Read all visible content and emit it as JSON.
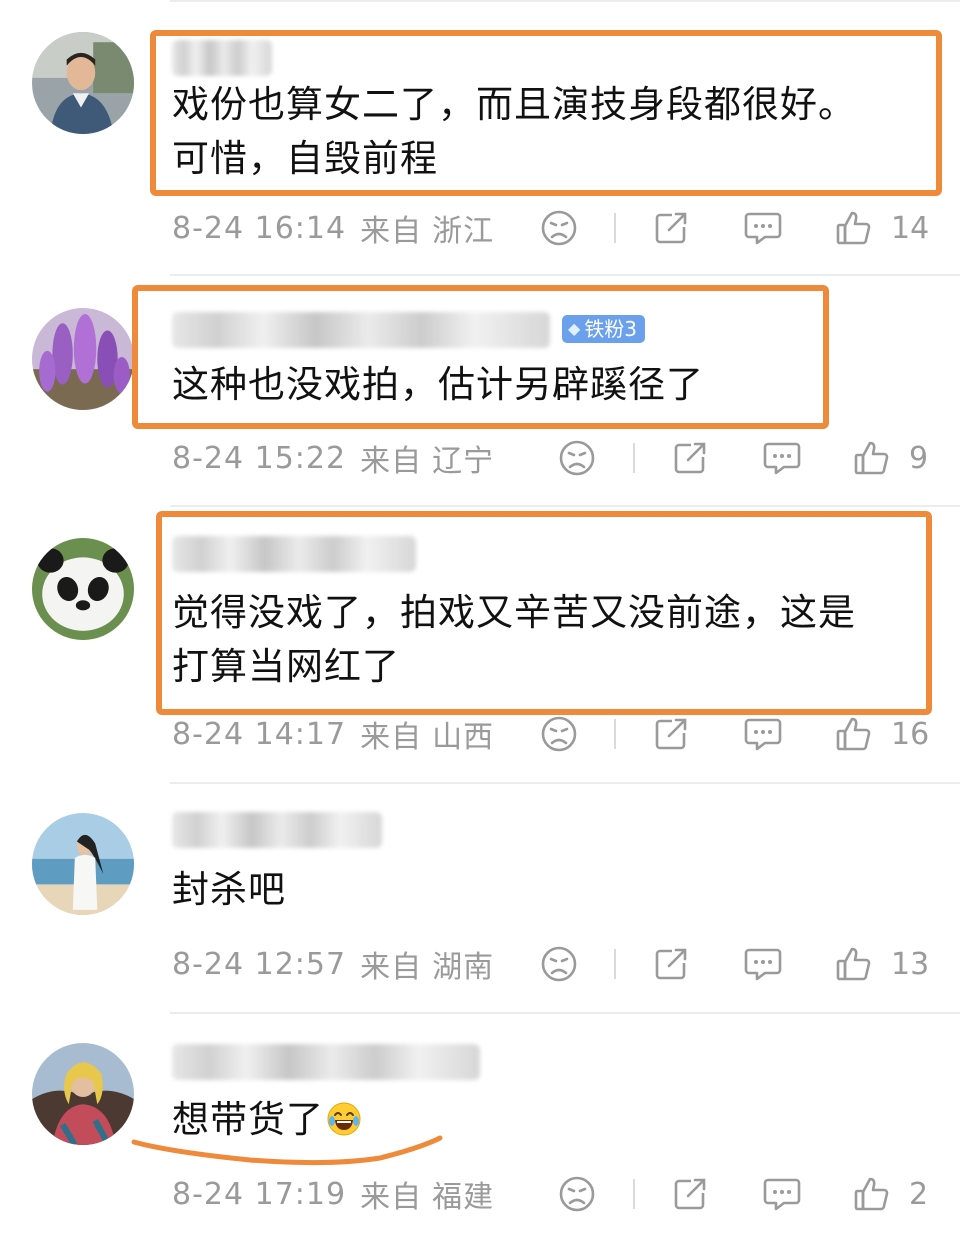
{
  "comments": [
    {
      "text_lines": [
        "戏份也算女二了，而且演技身段都很好。",
        "可惜，自毁前程"
      ],
      "date": "8-24 16:14",
      "from_label": "来自",
      "location": "浙江",
      "likes": "14",
      "avatar": "young-man-photo",
      "highlight": "orange-box"
    },
    {
      "text_lines": [
        "这种也没戏拍，估计另辟蹊径了"
      ],
      "badge": "铁粉3",
      "date": "8-24 15:22",
      "from_label": "来自",
      "location": "辽宁",
      "likes": "9",
      "avatar": "purple-flowers-photo",
      "highlight": "orange-box"
    },
    {
      "text_lines": [
        "觉得没戏了，拍戏又辛苦又没前途，这是",
        "打算当网红了"
      ],
      "date": "8-24 14:17",
      "from_label": "来自",
      "location": "山西",
      "likes": "16",
      "avatar": "panda-photo",
      "highlight": "orange-box"
    },
    {
      "text_lines": [
        "封杀吧"
      ],
      "date": "8-24 12:57",
      "from_label": "来自",
      "location": "湖南",
      "likes": "13",
      "avatar": "beach-woman-photo"
    },
    {
      "text_lines": [
        "想带货了"
      ],
      "date": "8-24 17:19",
      "from_label": "来自",
      "location": "福建",
      "likes": "2",
      "avatar": "colorful-portrait-photo",
      "highlight": "orange-underline",
      "emoji": "laughing-tears-emoji"
    }
  ],
  "colors": {
    "highlight": "#ee8a3a",
    "meta_text": "#9a9a9a",
    "badge_bg": "#6aa0ec",
    "divider": "#ececec"
  },
  "icons": [
    "dislike-face-icon",
    "share-icon",
    "comment-icon",
    "like-thumb-icon"
  ]
}
